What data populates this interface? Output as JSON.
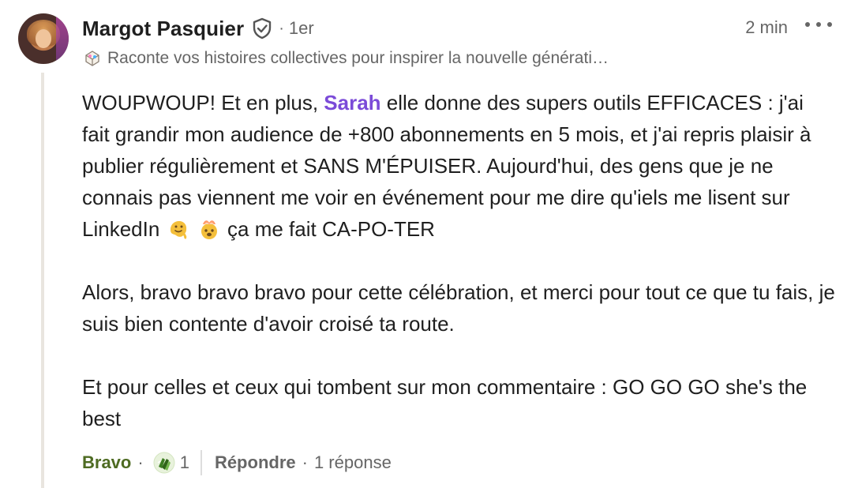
{
  "author": {
    "name": "Margot Pasquier",
    "degree": "1er",
    "headline": "Raconte vos histoires collectives pour inspirer la nouvelle générati…",
    "time_ago": "2 min"
  },
  "comment": {
    "paragraphs": [
      {
        "before": "WOUPWOUP! Et en plus, ",
        "mention": "Sarah",
        "after": " elle donne des supers outils EFFICACES : j'ai fait grandir mon audience de +800 abonnements en 5 mois, et j'ai repris plaisir à publier régulièrement et SANS M'ÉPUISER. Aujourd'hui, des gens que je ne connais pas viennent me voir en événement pour me dire qu'iels me lisent sur LinkedIn",
        "tail": " ça me fait CA-PO-TER"
      },
      {
        "text": "Alors, bravo bravo bravo pour cette célébration, et merci pour tout ce que tu fais, je suis bien contente d'avoir croisé ta route."
      },
      {
        "text": "Et pour celles et ceux qui tombent sur mon commentaire : GO GO GO she's the best"
      }
    ]
  },
  "actions": {
    "bravo_label": "Bravo",
    "bullet": "·",
    "reaction_count": "1",
    "reply_label": "Répondre",
    "replies": "1 réponse"
  },
  "icons": {
    "verified": "verified-shield-icon",
    "headline": "colorful-folded-icon",
    "reaction": "clapping-hands-icon",
    "more": "more-dots-icon"
  },
  "colors": {
    "mention": "#7b4bd8",
    "bravo": "#4e6b22",
    "muted": "#666666"
  }
}
